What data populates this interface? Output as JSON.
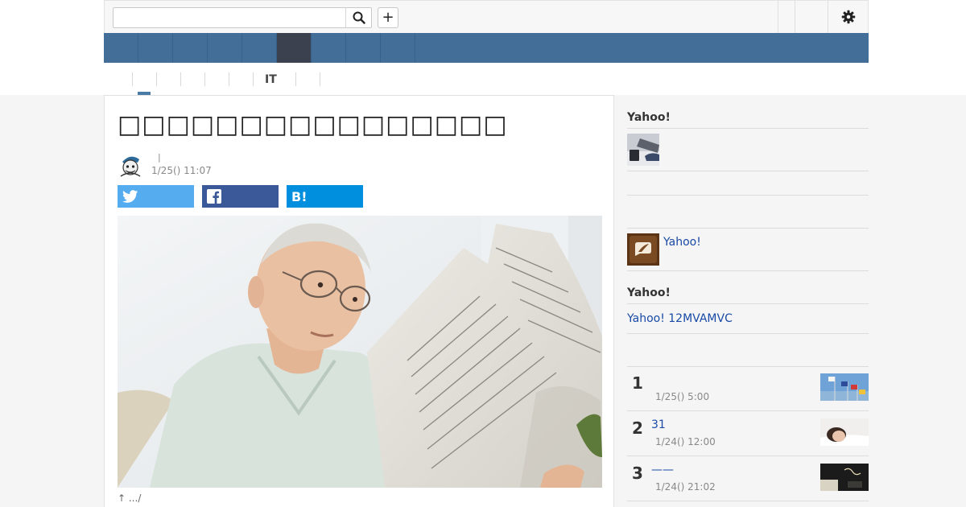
{
  "header": {
    "search_value": "",
    "search_placeholder": "",
    "plus_label": "+",
    "icons": {
      "search": "search-icon",
      "settings": "gear-icon"
    }
  },
  "nav": {
    "item_count": 9,
    "active_index": 5
  },
  "subnav": {
    "it_label": "IT"
  },
  "article": {
    "title": "□□□□□□□□□□□□□□□□",
    "author_separator": "|",
    "date": "1/25() 11:07",
    "share": {
      "twitter_icon": "twitter-icon",
      "facebook_icon": "facebook-icon",
      "hatena_label": "B!"
    },
    "caption": "↑ .../"
  },
  "sidebar": {
    "section1": {
      "heading": "Yahoo!"
    },
    "section2": {
      "link": "Yahoo!"
    },
    "section3": {
      "heading": "Yahoo!",
      "link": "Yahoo! 12MVAMVC"
    },
    "ranking": [
      {
        "rank": "1",
        "title": "",
        "date": "1/25() 5:00"
      },
      {
        "rank": "2",
        "title": "31",
        "date": "1/24() 12:00"
      },
      {
        "rank": "3",
        "title": "——",
        "date": "1/24() 21:02"
      }
    ]
  },
  "colors": {
    "nav": "#426e97",
    "nav_active": "#3b414f",
    "twitter": "#55acee",
    "facebook": "#3b5998",
    "hatena": "#008fde",
    "link": "#1a4aa6"
  }
}
